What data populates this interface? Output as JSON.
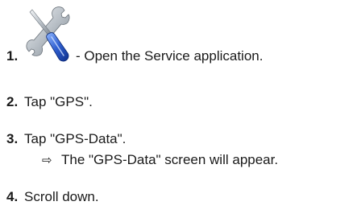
{
  "steps": [
    {
      "number": "1.",
      "icon": "service-tools-icon",
      "text": "- Open the Service application."
    },
    {
      "number": "2.",
      "text": "Tap \"GPS\"."
    },
    {
      "number": "3.",
      "text": "Tap \"GPS-Data\".",
      "result": {
        "arrow": "⇨",
        "text": "The \"GPS-Data\" screen will appear."
      }
    },
    {
      "number": "4.",
      "text": "Scroll down."
    }
  ]
}
